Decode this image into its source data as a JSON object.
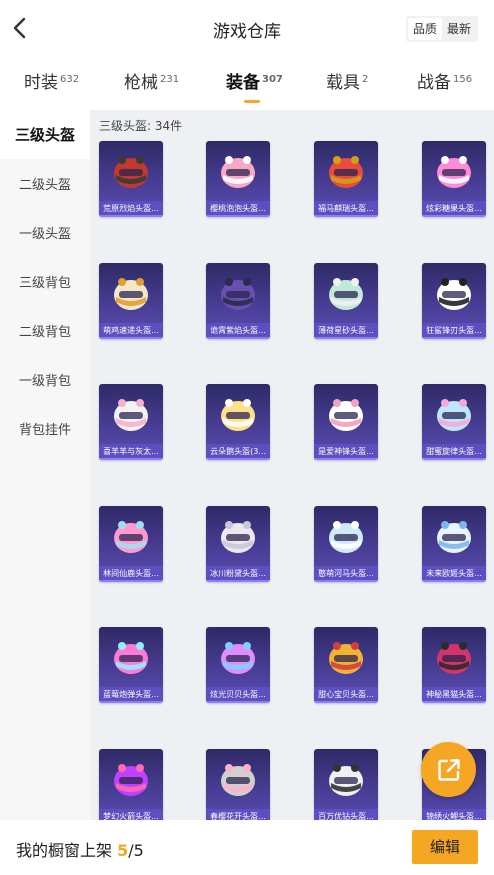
{
  "header": {
    "title": "游戏仓库",
    "sort_options": [
      "品质",
      "最新"
    ],
    "sort_active": 0
  },
  "categories": [
    {
      "label": "时装",
      "count": "632"
    },
    {
      "label": "枪械",
      "count": "231"
    },
    {
      "label": "装备",
      "count": "307"
    },
    {
      "label": "载具",
      "count": "2"
    },
    {
      "label": "战备",
      "count": "156"
    }
  ],
  "active_category": 2,
  "sidebar": [
    "三级头盔",
    "二级头盔",
    "一级头盔",
    "三级背包",
    "二级背包",
    "一级背包",
    "背包挂件"
  ],
  "sidebar_active": 0,
  "section_title": "三级头盔: 34件",
  "items": [
    {
      "name": "荒原烈焰头盔...",
      "c1": "#c0392b",
      "c2": "#3a3a3a"
    },
    {
      "name": "樱桃泡泡头盔...",
      "c1": "#f7a8c4",
      "c2": "#ffffff"
    },
    {
      "name": "福马麒瑞头盔...",
      "c1": "#e74c3c",
      "c2": "#d4a017"
    },
    {
      "name": "炫彩糖果头盔...",
      "c1": "#ff8ad8",
      "c2": "#ffffff"
    },
    {
      "name": "萌鸡速递头盔...",
      "c1": "#f5e6c8",
      "c2": "#e0a030"
    },
    {
      "name": "诡霄紫焰头盔...",
      "c1": "#6a4fb3",
      "c2": "#2b2b4a"
    },
    {
      "name": "薄荷星砂头盔...",
      "c1": "#bfe9d9",
      "c2": "#f0f0f0"
    },
    {
      "name": "狂鲨锋刃头盔...",
      "c1": "#ffffff",
      "c2": "#222222"
    },
    {
      "name": "喜羊羊与灰太...",
      "c1": "#f2f2f2",
      "c2": "#f7b0c8"
    },
    {
      "name": "云朵鹅头盔(3...",
      "c1": "#ffe08a",
      "c2": "#ffffff"
    },
    {
      "name": "是爱神锋头盔...",
      "c1": "#ffffff",
      "c2": "#f2a0c0"
    },
    {
      "name": "甜蜜旋律头盔...",
      "c1": "#bde7ff",
      "c2": "#f7a8d8"
    },
    {
      "name": "林间仙鹿头盔...",
      "c1": "#ff9ad0",
      "c2": "#9fe0f0"
    },
    {
      "name": "冰川粉黛头盔...",
      "c1": "#f0e6f0",
      "c2": "#c8c8d8"
    },
    {
      "name": "憨萌河马头盔...",
      "c1": "#cfe9f7",
      "c2": "#ffffff"
    },
    {
      "name": "未来欧姬头盔...",
      "c1": "#e8f4ff",
      "c2": "#7fb8e8"
    },
    {
      "name": "蓝莓炮弹头盔...",
      "c1": "#ff7ad6",
      "c2": "#8ff0ff"
    },
    {
      "name": "炫光贝贝头盔...",
      "c1": "#e08cff",
      "c2": "#7fd0ff"
    },
    {
      "name": "甜心宝贝头盔...",
      "c1": "#f2b233",
      "c2": "#d04040"
    },
    {
      "name": "神秘黑猫头盔...",
      "c1": "#d6336c",
      "c2": "#2b2b2b"
    },
    {
      "name": "梦幻火箭头盔...",
      "c1": "#c040ff",
      "c2": "#ff6ab0"
    },
    {
      "name": "春樱花开头盔...",
      "c1": "#d0d0d0",
      "c2": "#ffb0c8"
    },
    {
      "name": "百万优钻头盔...",
      "c1": "#f0f0f0",
      "c2": "#333333"
    },
    {
      "name": "锦绣火鲤头盔...",
      "c1": "#ff7a3a",
      "c2": "#ffffff"
    }
  ],
  "bottom": {
    "prefix": "我的橱窗上架 ",
    "current": "5",
    "suffix": "/5",
    "edit_label": "编辑"
  },
  "colors": {
    "accent": "#f5a623",
    "card_bg": "#4a3f98",
    "card_label": "#5d4fc0"
  }
}
